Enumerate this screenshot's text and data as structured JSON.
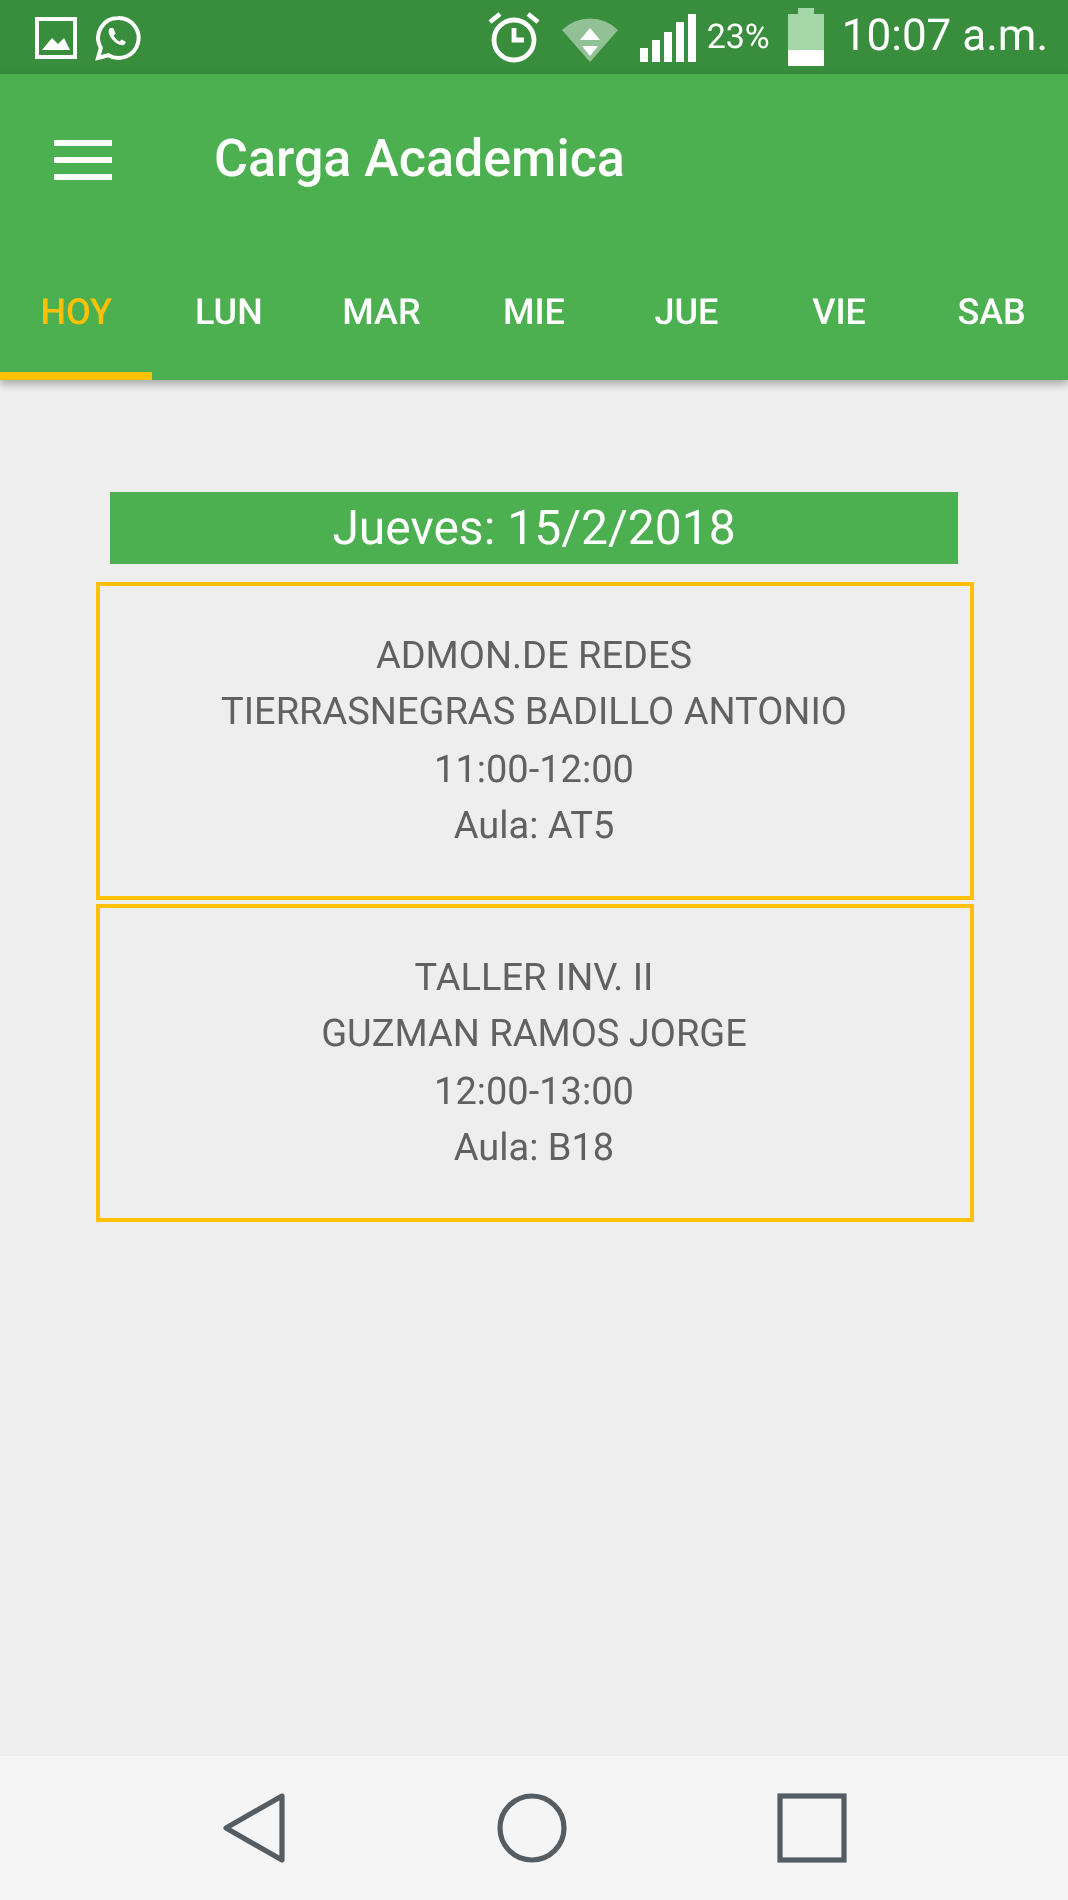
{
  "status_bar": {
    "battery_percent": "23%",
    "time": "10:07 a.m."
  },
  "app_bar": {
    "title": "Carga Academica"
  },
  "tabs": [
    {
      "label": "HOY",
      "selected": true
    },
    {
      "label": "LUN",
      "selected": false
    },
    {
      "label": "MAR",
      "selected": false
    },
    {
      "label": "MIE",
      "selected": false
    },
    {
      "label": "JUE",
      "selected": false
    },
    {
      "label": "VIE",
      "selected": false
    },
    {
      "label": "SAB",
      "selected": false
    }
  ],
  "date_header": "Jueves: 15/2/2018",
  "classes": [
    {
      "subject": "ADMON.DE REDES",
      "teacher": "TIERRASNEGRAS BADILLO ANTONIO",
      "time": "11:00-12:00",
      "room": "Aula: AT5"
    },
    {
      "subject": "TALLER INV. II",
      "teacher": "GUZMAN RAMOS JORGE",
      "time": "12:00-13:00",
      "room": "Aula: B18"
    }
  ]
}
